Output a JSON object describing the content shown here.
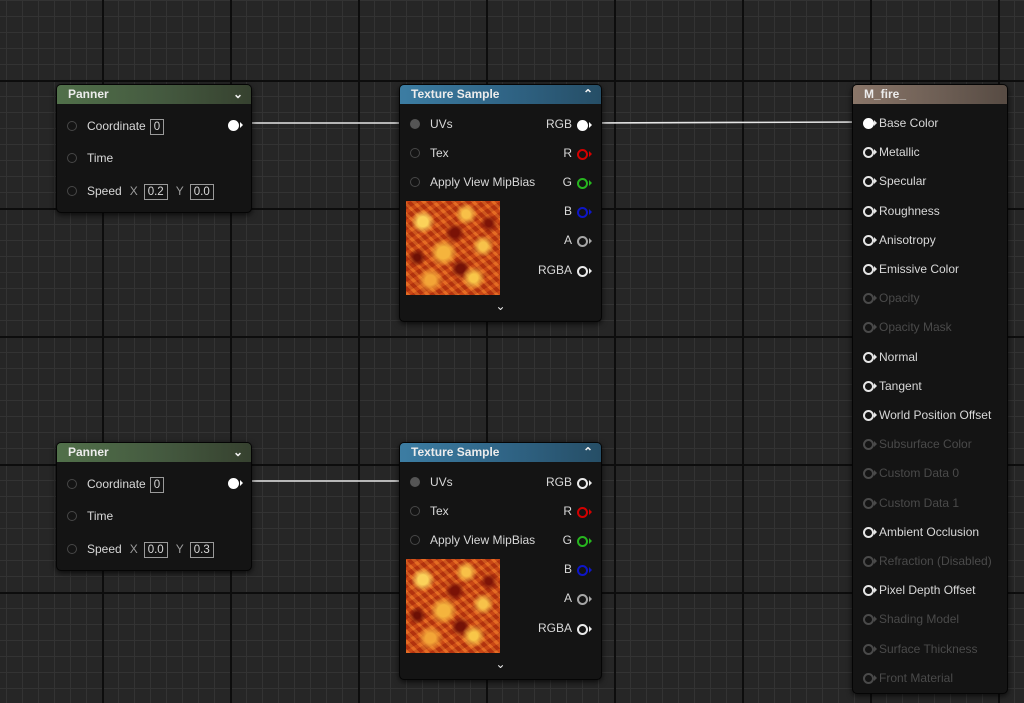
{
  "colors": {
    "canvas": "#262626",
    "panner_header": "#51704a",
    "texture_header": "#3c7da3",
    "material_header": "#8a7669",
    "pin_r": "#d40000",
    "pin_g": "#27b61f",
    "pin_b": "#0e16c8",
    "wire": "#e6e6e6"
  },
  "panner_nodes": [
    {
      "title": "Panner",
      "collapse_icon": "chevron-down-icon",
      "coordinate_label": "Coordinate",
      "coordinate_value": "0",
      "time_label": "Time",
      "speed_label": "Speed",
      "speed_x_label": "X",
      "speed_x": "0.2",
      "speed_y_label": "Y",
      "speed_y": "0.0"
    },
    {
      "title": "Panner",
      "collapse_icon": "chevron-down-icon",
      "coordinate_label": "Coordinate",
      "coordinate_value": "0",
      "time_label": "Time",
      "speed_label": "Speed",
      "speed_x_label": "X",
      "speed_x": "0.0",
      "speed_y_label": "Y",
      "speed_y": "0.3"
    }
  ],
  "texture_nodes": [
    {
      "title": "Texture Sample",
      "collapse_icon": "chevron-up-icon",
      "inputs": [
        "UVs",
        "Tex",
        "Apply View MipBias"
      ],
      "outputs": [
        "RGB",
        "R",
        "G",
        "B",
        "A",
        "RGBA"
      ],
      "thumbnail": "fire-texture-thumbnail",
      "expand_icon": "chevron-down-icon"
    },
    {
      "title": "Texture Sample",
      "collapse_icon": "chevron-up-icon",
      "inputs": [
        "UVs",
        "Tex",
        "Apply View MipBias"
      ],
      "outputs": [
        "RGB",
        "R",
        "G",
        "B",
        "A",
        "RGBA"
      ],
      "thumbnail": "fire-texture-thumbnail",
      "expand_icon": "chevron-down-icon"
    }
  ],
  "material_node": {
    "title": "M_fire_",
    "inputs": [
      {
        "label": "Base Color",
        "state": "connected"
      },
      {
        "label": "Metallic",
        "state": "enabled"
      },
      {
        "label": "Specular",
        "state": "enabled"
      },
      {
        "label": "Roughness",
        "state": "enabled"
      },
      {
        "label": "Anisotropy",
        "state": "enabled"
      },
      {
        "label": "Emissive Color",
        "state": "enabled"
      },
      {
        "label": "Opacity",
        "state": "disabled"
      },
      {
        "label": "Opacity Mask",
        "state": "disabled"
      },
      {
        "label": "Normal",
        "state": "enabled"
      },
      {
        "label": "Tangent",
        "state": "enabled"
      },
      {
        "label": "World Position Offset",
        "state": "enabled"
      },
      {
        "label": "Subsurface Color",
        "state": "disabled"
      },
      {
        "label": "Custom Data 0",
        "state": "disabled"
      },
      {
        "label": "Custom Data 1",
        "state": "disabled"
      },
      {
        "label": "Ambient Occlusion",
        "state": "enabled"
      },
      {
        "label": "Refraction (Disabled)",
        "state": "disabled"
      },
      {
        "label": "Pixel Depth Offset",
        "state": "enabled"
      },
      {
        "label": "Shading Model",
        "state": "disabled"
      },
      {
        "label": "Surface Thickness",
        "state": "disabled"
      },
      {
        "label": "Front Material",
        "state": "disabled"
      }
    ]
  }
}
